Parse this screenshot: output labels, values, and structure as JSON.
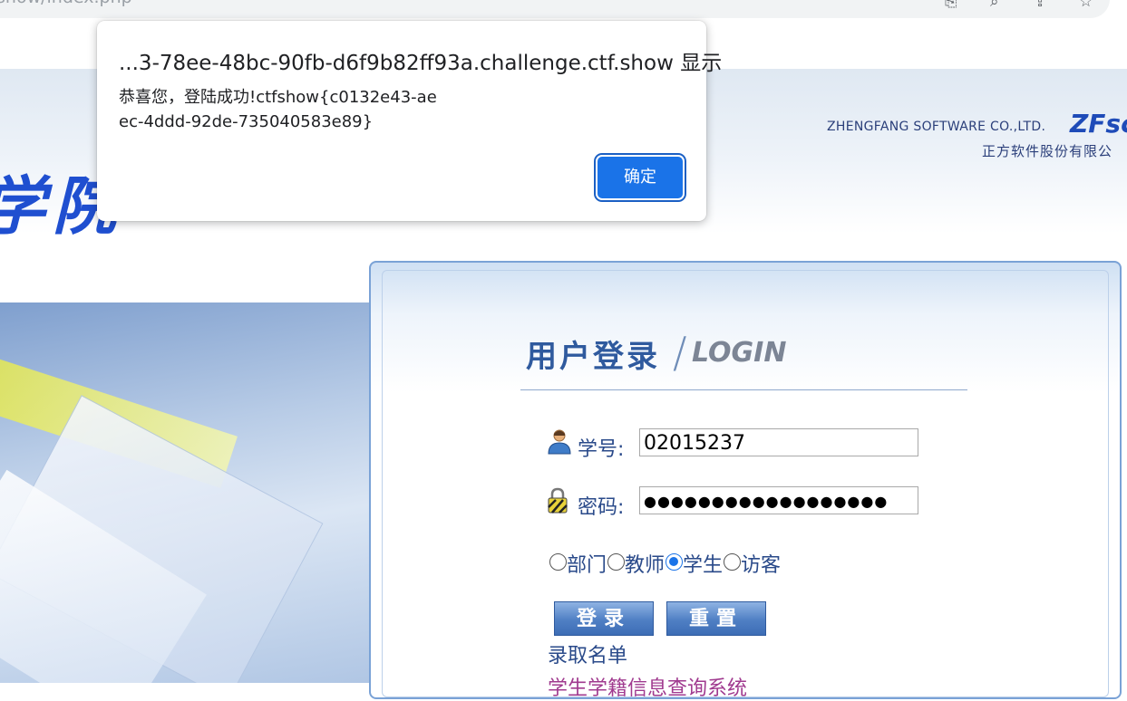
{
  "browser": {
    "url": "show/index.php"
  },
  "header": {
    "school_name_fragment": "学院",
    "company_en": "ZHENGFANG SOFTWARE CO.,LTD.",
    "company_logo": "ZFsc",
    "company_cn": "正方软件股份有限公"
  },
  "login": {
    "title": "用户登录",
    "title_en": "LOGIN",
    "student_id_label": "学号:",
    "student_id_value": "02015237",
    "password_label": "密码:",
    "password_value": "●●●●●●●●●●●●●●●●●●",
    "roles": [
      {
        "label": "部门",
        "checked": false
      },
      {
        "label": "教师",
        "checked": false
      },
      {
        "label": "学生",
        "checked": true
      },
      {
        "label": "访客",
        "checked": false
      }
    ],
    "login_button": "登录",
    "reset_button": "重置",
    "link_admission": "录取名单",
    "link_student_status": "学生学籍信息查询系统"
  },
  "alert": {
    "title": "...3-78ee-48bc-90fb-d6f9b82ff93a.challenge.ctf.show 显示",
    "message": "恭喜您，登陆成功!ctfshow{c0132e43-aeec-4ddd-92de-735040583e89}",
    "ok_button": "确定"
  },
  "colors": {
    "dialog_button": "#1a73e8",
    "login_title": "#2f5a9e",
    "link_visited": "#a03a8f"
  }
}
